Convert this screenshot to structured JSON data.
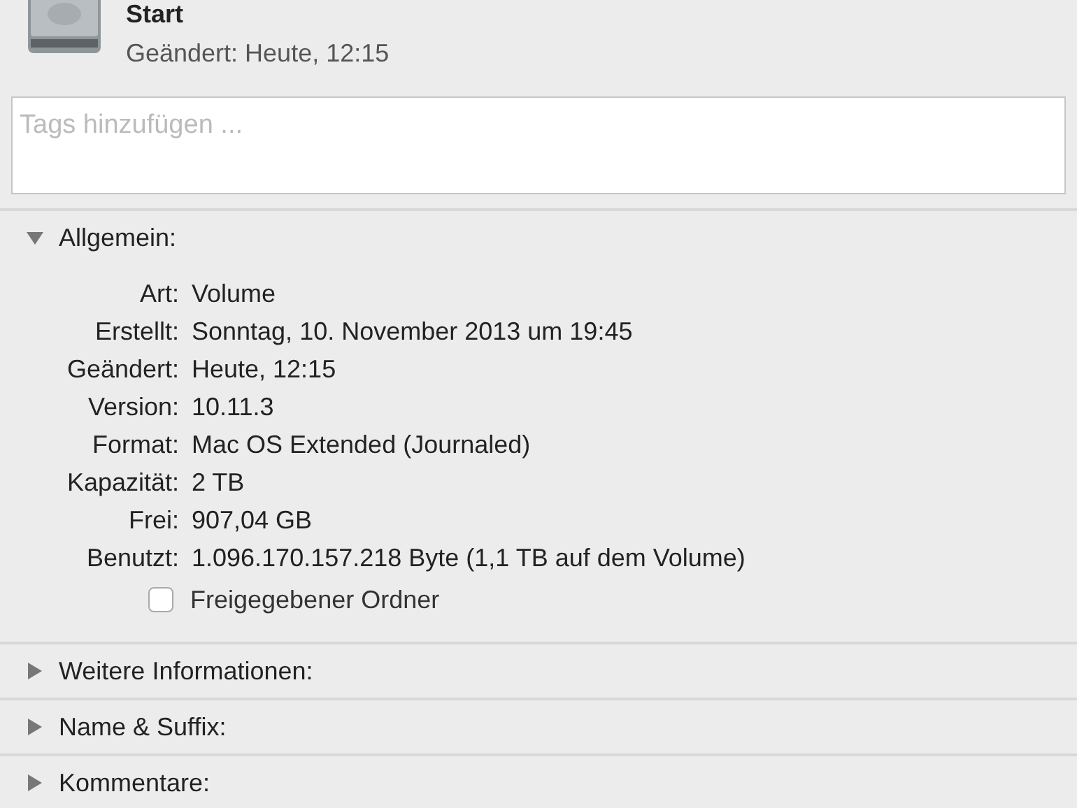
{
  "header": {
    "title": "Start",
    "subtitle": "Geändert: Heute, 12:15"
  },
  "tags": {
    "placeholder": "Tags hinzufügen ..."
  },
  "sections": [
    {
      "label": "Allgemein:",
      "expanded": true,
      "rows": [
        {
          "label": "Art:",
          "value": "Volume"
        },
        {
          "label": "Erstellt:",
          "value": "Sonntag, 10. November 2013 um 19:45"
        },
        {
          "label": "Geändert:",
          "value": "Heute, 12:15"
        },
        {
          "label": "Version:",
          "value": "10.11.3"
        },
        {
          "label": "Format:",
          "value": "Mac OS Extended (Journaled)"
        },
        {
          "label": "Kapazität:",
          "value": "2 TB"
        },
        {
          "label": "Frei:",
          "value": "907,04 GB"
        },
        {
          "label": "Benutzt:",
          "value": "1.096.170.157.218 Byte (1,1 TB auf dem Volume)"
        }
      ],
      "checkbox": {
        "label": "Freigegebener Ordner",
        "checked": false
      }
    },
    {
      "label": "Weitere Informationen:",
      "expanded": false
    },
    {
      "label": "Name & Suffix:",
      "expanded": false
    },
    {
      "label": "Kommentare:",
      "expanded": false
    }
  ]
}
